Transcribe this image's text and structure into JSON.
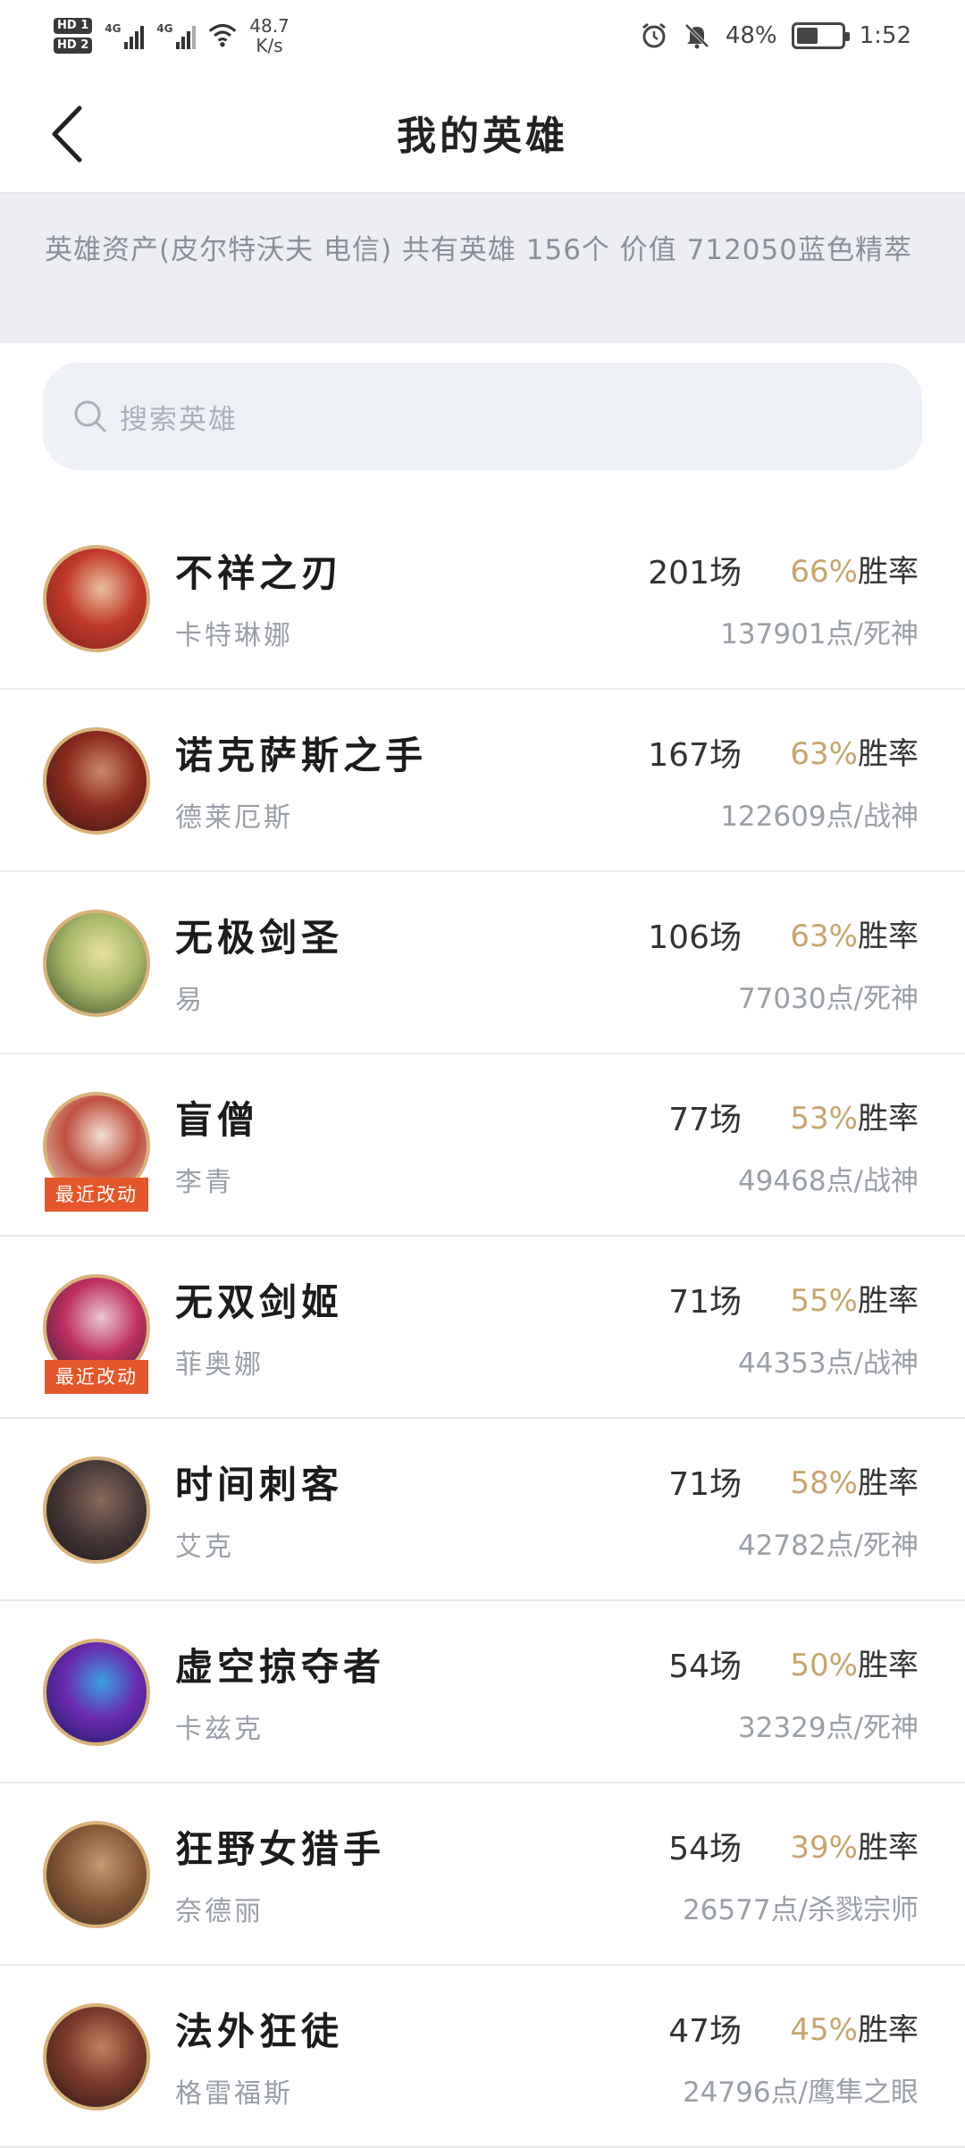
{
  "status_bar": {
    "hd1": "HD 1",
    "hd2": "HD 2",
    "net1": "4G",
    "net2": "4G",
    "speed_value": "48.7",
    "speed_unit": "K/s",
    "battery": "48%",
    "battery_level": 0.48,
    "time": "1:52"
  },
  "nav": {
    "title": "我的英雄"
  },
  "banner": {
    "text": "英雄资产(皮尔特沃夫 电信) 共有英雄 156个  价值 712050蓝色精萃"
  },
  "search": {
    "placeholder": "搜索英雄"
  },
  "heroes": [
    {
      "title": "不祥之刃",
      "name": "卡特琳娜",
      "games": "201场",
      "rate": "66%",
      "rate_label": "胜率",
      "points": "137901点/死神",
      "tag": "",
      "colors": [
        "#7a1f1f",
        "#c23a2a",
        "#e9c0a0"
      ]
    },
    {
      "title": "诺克萨斯之手",
      "name": "德莱厄斯",
      "games": "167场",
      "rate": "63%",
      "rate_label": "胜率",
      "points": "122609点/战神",
      "tag": "",
      "colors": [
        "#3a1a14",
        "#8b2a1e",
        "#c98a6a"
      ]
    },
    {
      "title": "无极剑圣",
      "name": "易",
      "games": "106场",
      "rate": "63%",
      "rate_label": "胜率",
      "points": "77030点/死神",
      "tag": "",
      "colors": [
        "#3b4a2a",
        "#a8b86a",
        "#e8e0a0"
      ]
    },
    {
      "title": "盲僧",
      "name": "李青",
      "games": "77场",
      "rate": "53%",
      "rate_label": "胜率",
      "points": "49468点/战神",
      "tag": "最近改动",
      "colors": [
        "#e8d8c8",
        "#c05040",
        "#f0e0d0"
      ]
    },
    {
      "title": "无双剑姬",
      "name": "菲奥娜",
      "games": "71场",
      "rate": "55%",
      "rate_label": "胜率",
      "points": "44353点/战神",
      "tag": "最近改动",
      "colors": [
        "#3a1a3a",
        "#c03060",
        "#e8c8d0"
      ]
    },
    {
      "title": "时间刺客",
      "name": "艾克",
      "games": "71场",
      "rate": "58%",
      "rate_label": "胜率",
      "points": "42782点/死神",
      "tag": "",
      "colors": [
        "#1a1418",
        "#4a3a3a",
        "#8a6a5a"
      ]
    },
    {
      "title": "虚空掠夺者",
      "name": "卡兹克",
      "games": "54场",
      "rate": "50%",
      "rate_label": "胜率",
      "points": "32329点/死神",
      "tag": "",
      "colors": [
        "#1a1a5a",
        "#6a2ab0",
        "#3aa0e0"
      ]
    },
    {
      "title": "狂野女猎手",
      "name": "奈德丽",
      "games": "54场",
      "rate": "39%",
      "rate_label": "胜率",
      "points": "26577点/杀戮宗师",
      "tag": "",
      "colors": [
        "#3a2a1a",
        "#8a5a3a",
        "#c89870"
      ]
    },
    {
      "title": "法外狂徒",
      "name": "格雷福斯",
      "games": "47场",
      "rate": "45%",
      "rate_label": "胜率",
      "points": "24796点/鹰隼之眼",
      "tag": "",
      "colors": [
        "#2a1a14",
        "#7a3a2a",
        "#c08060"
      ]
    }
  ]
}
